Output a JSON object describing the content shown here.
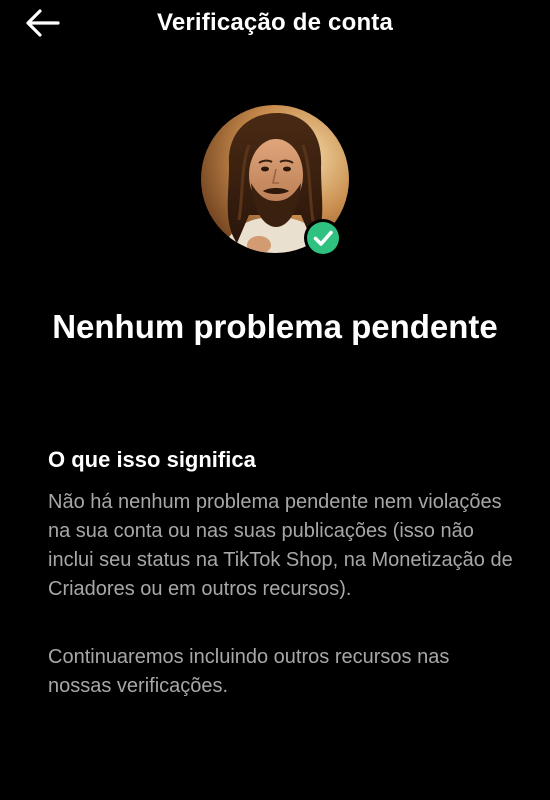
{
  "header": {
    "back_icon": "arrow-left-icon",
    "title": "Verificação de conta"
  },
  "profile": {
    "avatar_description": "profile-photo",
    "badge_icon": "check-circle-icon",
    "badge_color": "#2fc17f"
  },
  "status": {
    "title": "Nenhum problema pendente"
  },
  "info": {
    "heading": "O que isso significa",
    "paragraph_1": "Não há nenhum problema pendente nem violações na sua conta ou nas suas publicações (isso não inclui seu status na TikTok Shop, na Monetização de Criadores ou em outros recursos).",
    "paragraph_2": "Continuaremos incluindo outros recursos nas nossas verificações."
  },
  "colors": {
    "background": "#000000",
    "text_primary": "#ffffff",
    "text_secondary": "#a7a7a7",
    "accent_green": "#2fc17f"
  }
}
